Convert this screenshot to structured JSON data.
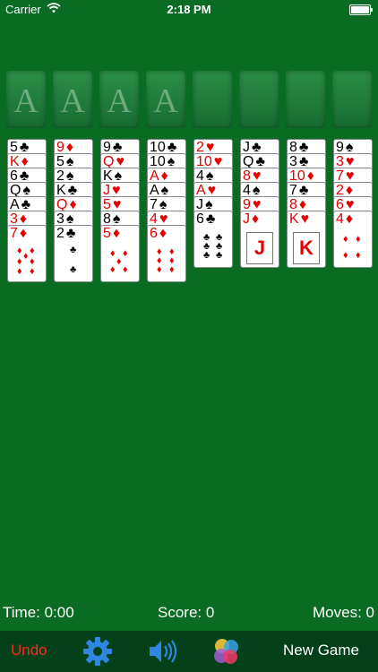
{
  "status": {
    "carrier": "Carrier",
    "time": "2:18 PM"
  },
  "foundations": [
    "A",
    "A",
    "A",
    "A"
  ],
  "free_cells": [
    null,
    null,
    null,
    null
  ],
  "tableau": [
    [
      {
        "rank": "5",
        "suit": "♣",
        "color": "black"
      },
      {
        "rank": "K",
        "suit": "♦",
        "color": "red"
      },
      {
        "rank": "6",
        "suit": "♣",
        "color": "black"
      },
      {
        "rank": "Q",
        "suit": "♠",
        "color": "black"
      },
      {
        "rank": "A",
        "suit": "♣",
        "color": "black"
      },
      {
        "rank": "3",
        "suit": "♦",
        "color": "red"
      },
      {
        "rank": "7",
        "suit": "♦",
        "color": "red"
      }
    ],
    [
      {
        "rank": "9",
        "suit": "♦",
        "color": "red"
      },
      {
        "rank": "5",
        "suit": "♠",
        "color": "black"
      },
      {
        "rank": "2",
        "suit": "♠",
        "color": "black"
      },
      {
        "rank": "K",
        "suit": "♣",
        "color": "black"
      },
      {
        "rank": "Q",
        "suit": "♦",
        "color": "red"
      },
      {
        "rank": "3",
        "suit": "♠",
        "color": "black"
      },
      {
        "rank": "2",
        "suit": "♣",
        "color": "black"
      }
    ],
    [
      {
        "rank": "9",
        "suit": "♣",
        "color": "black"
      },
      {
        "rank": "Q",
        "suit": "♥",
        "color": "red"
      },
      {
        "rank": "K",
        "suit": "♠",
        "color": "black"
      },
      {
        "rank": "J",
        "suit": "♥",
        "color": "red"
      },
      {
        "rank": "5",
        "suit": "♥",
        "color": "red"
      },
      {
        "rank": "8",
        "suit": "♠",
        "color": "black"
      },
      {
        "rank": "5",
        "suit": "♦",
        "color": "red"
      }
    ],
    [
      {
        "rank": "10",
        "suit": "♣",
        "color": "black"
      },
      {
        "rank": "10",
        "suit": "♠",
        "color": "black"
      },
      {
        "rank": "A",
        "suit": "♦",
        "color": "red"
      },
      {
        "rank": "A",
        "suit": "♠",
        "color": "black"
      },
      {
        "rank": "7",
        "suit": "♠",
        "color": "black"
      },
      {
        "rank": "4",
        "suit": "♥",
        "color": "red"
      },
      {
        "rank": "6",
        "suit": "♦",
        "color": "red"
      }
    ],
    [
      {
        "rank": "2",
        "suit": "♥",
        "color": "red"
      },
      {
        "rank": "10",
        "suit": "♥",
        "color": "red"
      },
      {
        "rank": "4",
        "suit": "♠",
        "color": "black"
      },
      {
        "rank": "A",
        "suit": "♥",
        "color": "red"
      },
      {
        "rank": "J",
        "suit": "♠",
        "color": "black"
      },
      {
        "rank": "6",
        "suit": "♣",
        "color": "black"
      }
    ],
    [
      {
        "rank": "J",
        "suit": "♣",
        "color": "black"
      },
      {
        "rank": "Q",
        "suit": "♣",
        "color": "black"
      },
      {
        "rank": "8",
        "suit": "♥",
        "color": "red"
      },
      {
        "rank": "4",
        "suit": "♠",
        "color": "black"
      },
      {
        "rank": "9",
        "suit": "♥",
        "color": "red"
      },
      {
        "rank": "J",
        "suit": "♦",
        "color": "red"
      }
    ],
    [
      {
        "rank": "8",
        "suit": "♣",
        "color": "black"
      },
      {
        "rank": "3",
        "suit": "♣",
        "color": "black"
      },
      {
        "rank": "10",
        "suit": "♦",
        "color": "red"
      },
      {
        "rank": "7",
        "suit": "♣",
        "color": "black"
      },
      {
        "rank": "8",
        "suit": "♦",
        "color": "red"
      },
      {
        "rank": "K",
        "suit": "♥",
        "color": "red"
      }
    ],
    [
      {
        "rank": "9",
        "suit": "♠",
        "color": "black"
      },
      {
        "rank": "3",
        "suit": "♥",
        "color": "red"
      },
      {
        "rank": "7",
        "suit": "♥",
        "color": "red"
      },
      {
        "rank": "2",
        "suit": "♦",
        "color": "red"
      },
      {
        "rank": "6",
        "suit": "♥",
        "color": "red"
      },
      {
        "rank": "4",
        "suit": "♦",
        "color": "red"
      }
    ]
  ],
  "info": {
    "time": "Time: 0:00",
    "score": "Score: 0",
    "moves": "Moves: 0"
  },
  "toolbar": {
    "undo": "Undo",
    "new_game": "New Game",
    "icons": [
      "gear-icon",
      "speaker-icon",
      "game-center-icon"
    ]
  },
  "colors": {
    "felt": "#0a6b22",
    "toolbar": "#04401a",
    "red_suit": "#e50000",
    "undo": "#ff2a20",
    "gear": "#2f86e0"
  }
}
